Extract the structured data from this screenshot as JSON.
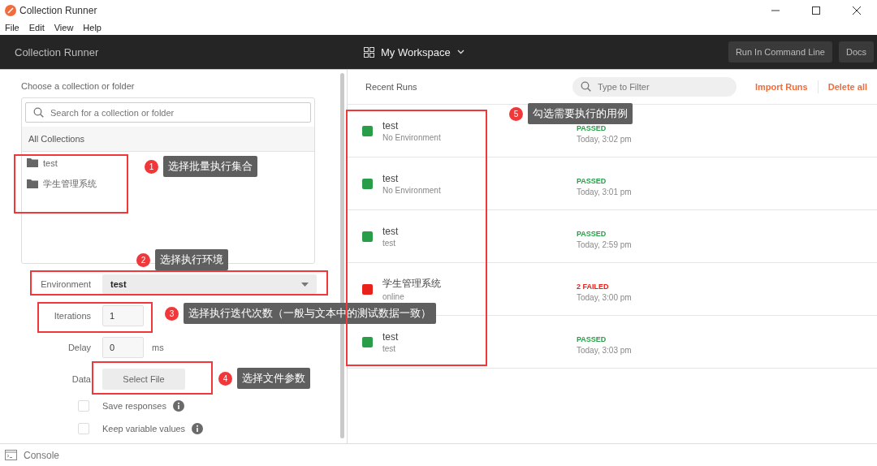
{
  "window": {
    "title": "Collection Runner"
  },
  "menu": [
    "File",
    "Edit",
    "View",
    "Help"
  ],
  "header": {
    "title": "Collection Runner",
    "workspace": "My Workspace",
    "buttons": [
      "Run In Command Line",
      "Docs"
    ]
  },
  "left": {
    "choose_label": "Choose a collection or folder",
    "search": {
      "placeholder": "Search for a collection or folder"
    },
    "list_header": "All Collections",
    "collections": [
      {
        "name": "test"
      },
      {
        "name": "学生管理系统"
      }
    ],
    "environment": {
      "label": "Environment",
      "value": "test"
    },
    "iterations": {
      "label": "Iterations",
      "value": "1"
    },
    "delay": {
      "label": "Delay",
      "value": "0",
      "unit": "ms"
    },
    "data": {
      "label": "Data",
      "button": "Select File"
    },
    "options": [
      {
        "label": "Save responses",
        "checked": false
      },
      {
        "label": "Keep variable values",
        "checked": false
      }
    ]
  },
  "right": {
    "title": "Recent Runs",
    "filter": {
      "placeholder": "Type to Filter"
    },
    "actions": [
      "Import Runs",
      "Delete all"
    ],
    "runs": [
      {
        "name": "test",
        "environment": "No Environment",
        "color": "#2a9d48",
        "status": "PASSED",
        "time": "Today, 3:02 pm"
      },
      {
        "name": "test",
        "environment": "No Environment",
        "color": "#2a9d48",
        "status": "PASSED",
        "time": "Today, 3:01 pm"
      },
      {
        "name": "test",
        "environment": "test",
        "color": "#2a9d48",
        "status": "PASSED",
        "time": "Today, 2:59 pm"
      },
      {
        "name": "学生管理系统",
        "environment": "online",
        "color": "#e8221a",
        "status": "2 FAILED",
        "time": "Today, 3:00 pm"
      },
      {
        "name": "test",
        "environment": "test",
        "color": "#2a9d48",
        "status": "PASSED",
        "time": "Today, 3:03 pm"
      }
    ]
  },
  "console": {
    "label": "Console"
  },
  "annotations": [
    {
      "number": "1",
      "text": "选择批量执行集合"
    },
    {
      "number": "2",
      "text": "选择执行环境"
    },
    {
      "number": "3",
      "text": "选择执行迭代次数（一般与文本中的测试数据一致）"
    },
    {
      "number": "4",
      "text": "选择文件参数"
    },
    {
      "number": "5",
      "text": "勾选需要执行的用例"
    }
  ]
}
